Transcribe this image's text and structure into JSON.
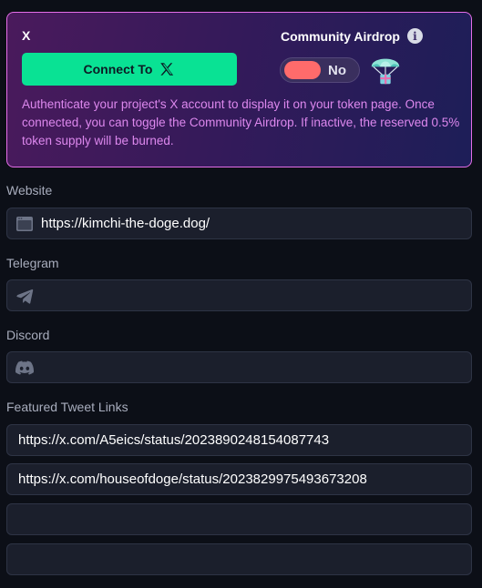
{
  "x_section": {
    "title": "X",
    "connect_label": "Connect To",
    "airdrop_title": "Community Airdrop",
    "airdrop_toggle_value": "No",
    "description": "Authenticate your project's X account to display it on your token page. Once connected, you can toggle the Community Airdrop. If inactive, the reserved 0.5% token supply will be burned."
  },
  "website": {
    "label": "Website",
    "value": "https://kimchi-the-doge.dog/",
    "placeholder": ""
  },
  "telegram": {
    "label": "Telegram",
    "value": "",
    "placeholder": ""
  },
  "discord": {
    "label": "Discord",
    "value": "",
    "placeholder": ""
  },
  "featured_tweets": {
    "label": "Featured Tweet Links",
    "links": [
      "https://x.com/A5eics/status/2023890248154087743",
      "https://x.com/houseofdoge/status/2023829975493673208",
      "",
      ""
    ]
  },
  "colors": {
    "connect_button": "#09e294",
    "toggle_off": "#ff6b6b",
    "card_border": "#e46ee8",
    "description_text": "#dd88ee"
  }
}
